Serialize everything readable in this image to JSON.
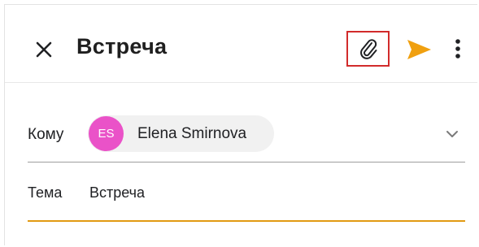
{
  "header": {
    "title": "Встреча",
    "icons": {
      "close": "close-icon",
      "attach": "paperclip-icon",
      "send": "send-icon",
      "more": "more-vert-icon"
    }
  },
  "recipient": {
    "label": "Кому",
    "chip": {
      "initials": "ES",
      "name": "Elena Smirnova"
    },
    "expand_icon": "chevron-down-icon"
  },
  "subject": {
    "label": "Тема",
    "value": "Встреча"
  },
  "colors": {
    "accent": "#f0a010",
    "highlight_border": "#d22b2b",
    "avatar": "#ea52c8",
    "underline_active": "#e29a12"
  }
}
